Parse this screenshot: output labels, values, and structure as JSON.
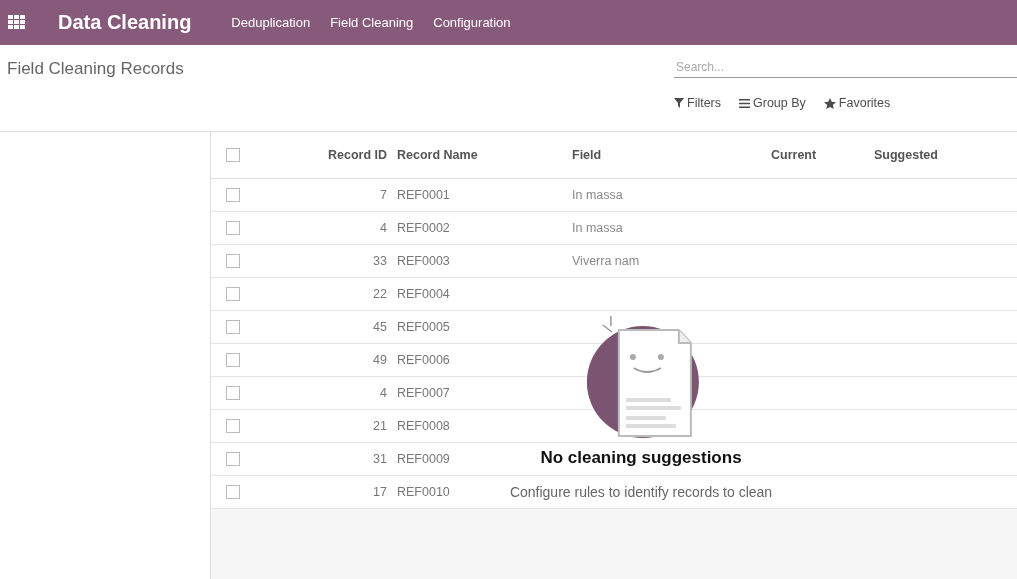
{
  "navbar": {
    "app_title": "Data Cleaning",
    "menu": [
      "Deduplication",
      "Field Cleaning",
      "Configuration"
    ]
  },
  "control_panel": {
    "breadcrumb": "Field Cleaning Records",
    "search": {
      "placeholder": "Search..."
    },
    "buttons": [
      {
        "kind": "filter",
        "label": "Filters"
      },
      {
        "kind": "group",
        "label": "Group By"
      },
      {
        "kind": "star",
        "label": "Favorites"
      }
    ]
  },
  "table": {
    "all_selected": false,
    "columns": [
      "Record ID",
      "Record Name",
      "Field",
      "Current",
      "Suggested"
    ],
    "rows": [
      {
        "selected": false,
        "id": "7",
        "name": "REF0001",
        "field": "In massa"
      },
      {
        "selected": false,
        "id": "4",
        "name": "REF0002",
        "field": "In massa"
      },
      {
        "selected": false,
        "id": "33",
        "name": "REF0003",
        "field": "Viverra nam"
      },
      {
        "selected": false,
        "id": "22",
        "name": "REF0004"
      },
      {
        "selected": false,
        "id": "45",
        "name": "REF0005"
      },
      {
        "selected": false,
        "id": "49",
        "name": "REF0006"
      },
      {
        "selected": false,
        "id": "4",
        "name": "REF0007"
      },
      {
        "selected": false,
        "id": "21",
        "name": "REF0008"
      },
      {
        "selected": false,
        "id": "31",
        "name": "REF0009"
      },
      {
        "selected": false,
        "id": "17",
        "name": "REF0010"
      }
    ]
  },
  "empty_state": {
    "title": "No cleaning suggestions",
    "message": "Configure rules to identify records to clean"
  }
}
